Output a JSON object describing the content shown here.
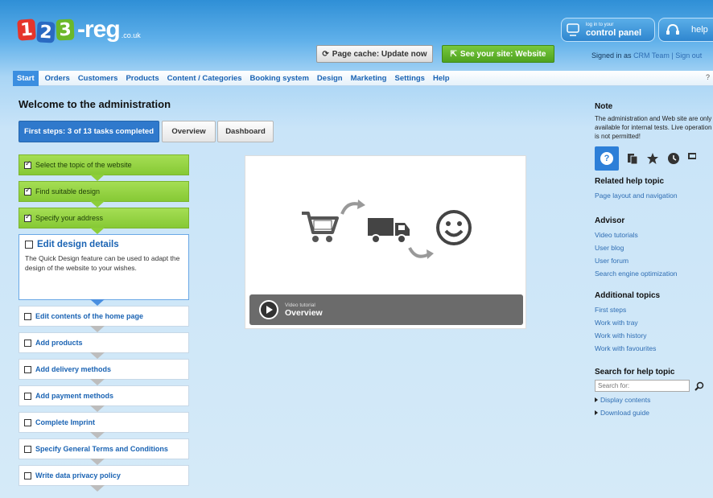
{
  "header": {
    "logo": {
      "d1": "1",
      "d2": "2",
      "d3": "3",
      "text": "-reg",
      "suffix": ".co.uk"
    },
    "cache_button": "Page cache: Update now",
    "site_button": "See your site: Website",
    "control_panel": {
      "small1": "log in to your",
      "big": "control panel"
    },
    "help": "help",
    "signed_in_label": "Signed in as",
    "signed_in_user": "CRM Team",
    "separator": "|",
    "sign_out": "Sign out"
  },
  "nav": {
    "items": [
      "Start",
      "Orders",
      "Customers",
      "Products",
      "Content / Categories",
      "Booking system",
      "Design",
      "Marketing",
      "Settings",
      "Help"
    ],
    "right": "?"
  },
  "main": {
    "title": "Welcome to the administration",
    "tabs": {
      "steps": "First steps: 3 of 13 tasks completed",
      "overview": "Overview",
      "dashboard": "Dashboard"
    },
    "steps_done": [
      "Select the topic of the website",
      "Find suitable design",
      "Specify your address"
    ],
    "current_step": {
      "title": "Edit design details",
      "desc": "The Quick Design feature can be used to adapt the design of the website to your wishes."
    },
    "steps_todo": [
      "Edit contents of the home page",
      "Add products",
      "Add delivery methods",
      "Add payment methods",
      "Complete Imprint",
      "Specify General Terms and Conditions",
      "Write data privacy policy"
    ]
  },
  "video": {
    "small_label": "Video tutorial",
    "title": "Overview"
  },
  "sidebar": {
    "note_title": "Note",
    "note_text": "The administration and Web site are only available for internal tests. Live operation is not permitted!",
    "related_title": "Related help topic",
    "related_link": "Page layout and navigation",
    "advisor_title": "Advisor",
    "advisor_links": [
      "Video tutorials",
      "User blog",
      "User forum",
      "Search engine optimization"
    ],
    "additional_title": "Additional topics",
    "additional_links": [
      "First steps",
      "Work with tray",
      "Work with history",
      "Work with favourites"
    ],
    "search_title": "Search for help topic",
    "search_placeholder": "Search for:",
    "display_contents": "Display contents",
    "download_guide": "Download guide"
  },
  "colors": {
    "accent": "#2f79cc",
    "done_green": "#8cce39",
    "link": "#1a63b3"
  }
}
